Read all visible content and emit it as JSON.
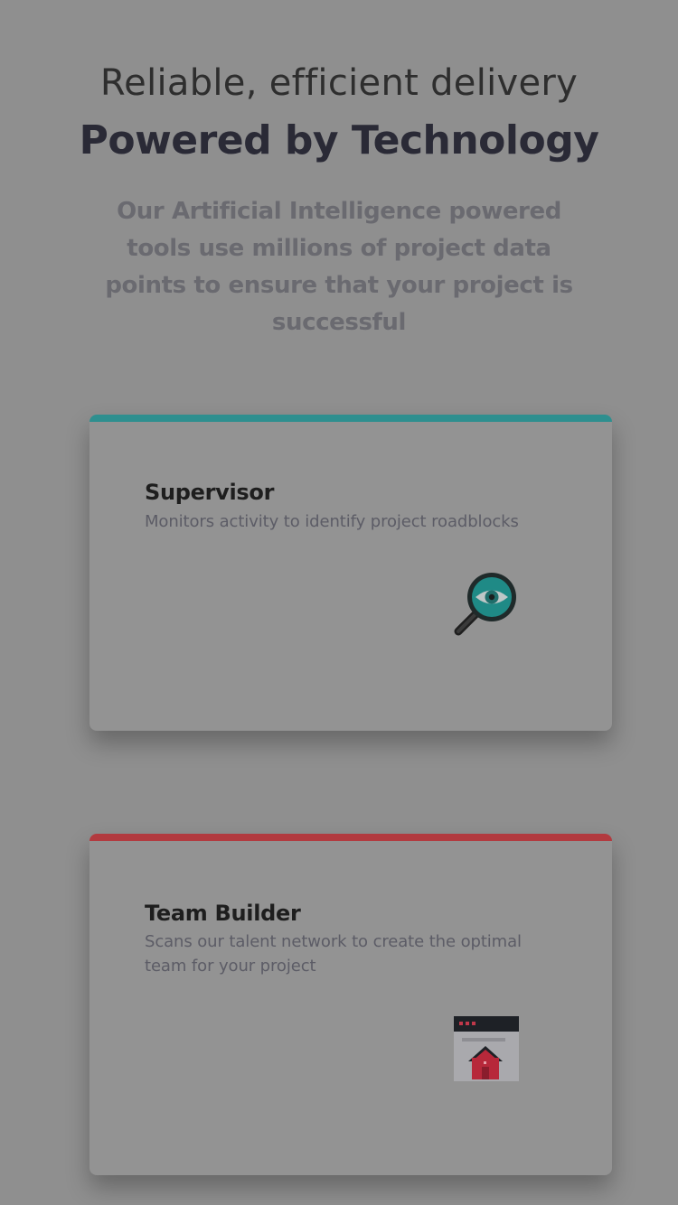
{
  "hero": {
    "tagline": "Reliable, efficient delivery",
    "headline": "Powered by Technology",
    "subtext": "Our Artificial Intelligence powered tools use millions of project data points to ensure that your project is successful"
  },
  "cards": [
    {
      "title": "Supervisor",
      "description": "Monitors activity to identify project roadblocks",
      "accent_color": "#2e8f8f",
      "icon": "magnifier-eye-icon"
    },
    {
      "title": "Team Builder",
      "description": "Scans our talent network to create the optimal team for your project",
      "accent_color": "#b23a3f",
      "icon": "browser-home-icon"
    }
  ],
  "colors": {
    "background": "#8f8f8f",
    "card": "#939393"
  }
}
